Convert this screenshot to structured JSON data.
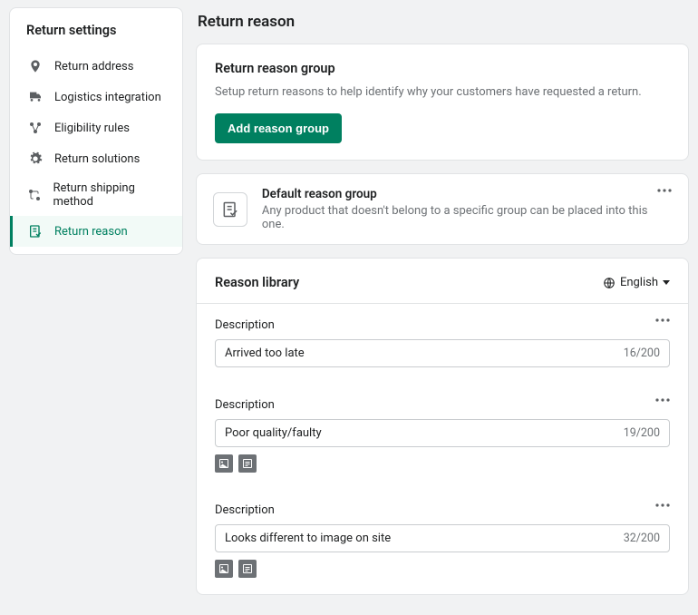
{
  "sidebar": {
    "title": "Return settings",
    "items": [
      {
        "label": "Return address"
      },
      {
        "label": "Logistics integration"
      },
      {
        "label": "Eligibility rules"
      },
      {
        "label": "Return solutions"
      },
      {
        "label": "Return shipping method"
      },
      {
        "label": "Return reason"
      }
    ],
    "active_index": 5
  },
  "page": {
    "title": "Return reason"
  },
  "group_card": {
    "title": "Return reason group",
    "subtitle": "Setup return reasons to help identify why your customers have requested a return.",
    "button": "Add reason group"
  },
  "default_group": {
    "title": "Default reason group",
    "subtitle": "Any product that doesn't belong to a specific group can be placed into this one."
  },
  "library": {
    "title": "Reason library",
    "language": "English"
  },
  "reasons": [
    {
      "label": "Description",
      "value": "Arrived too late",
      "count": "16/200",
      "has_attachments": false
    },
    {
      "label": "Description",
      "value": "Poor quality/faulty",
      "count": "19/200",
      "has_attachments": true
    },
    {
      "label": "Description",
      "value": "Looks different to image on site",
      "count": "32/200",
      "has_attachments": true
    }
  ]
}
